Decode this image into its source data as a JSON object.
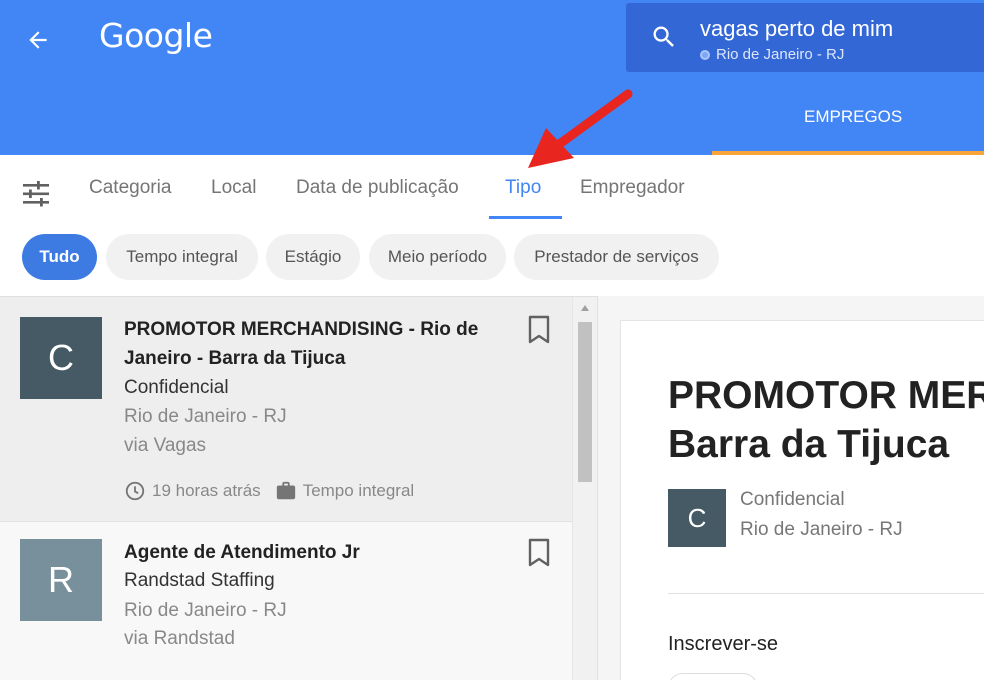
{
  "header": {
    "logo": "Google",
    "search_query": "vagas perto de mim",
    "search_location": "Rio de Janeiro - RJ",
    "tab_label": "EMPREGOS",
    "colors": {
      "bar": "#4285f4",
      "search": "#3367d6",
      "tab_underline": "#f9a53c"
    }
  },
  "filter_tabs": [
    {
      "label": "Categoria",
      "active": false
    },
    {
      "label": "Local",
      "active": false
    },
    {
      "label": "Data de publicação",
      "active": false
    },
    {
      "label": "Tipo",
      "active": true
    },
    {
      "label": "Empregador",
      "active": false
    }
  ],
  "chips": [
    {
      "label": "Tudo",
      "active": true
    },
    {
      "label": "Tempo integral",
      "active": false
    },
    {
      "label": "Estágio",
      "active": false
    },
    {
      "label": "Meio período",
      "active": false
    },
    {
      "label": "Prestador de serviços",
      "active": false
    }
  ],
  "jobs": [
    {
      "initial": "C",
      "avatar_color": "#455a64",
      "title": "PROMOTOR MERCHANDISING - Rio de Janeiro - Barra da Tijuca",
      "company": "Confidencial",
      "location": "Rio de Janeiro - RJ",
      "via": "via Vagas",
      "posted": "19 horas atrás",
      "type": "Tempo integral",
      "selected": true
    },
    {
      "initial": "R",
      "avatar_color": "#78909c",
      "title": "Agente de Atendimento Jr",
      "company": "Randstad Staffing",
      "location": "Rio de Janeiro - RJ",
      "via": "via Randstad",
      "selected": false
    }
  ],
  "detail": {
    "title_line1": "PROMOTOR MERCHANDISING - Rio de Janeiro -",
    "title_line2": "Barra da Tijuca",
    "initial": "C",
    "company": "Confidencial",
    "location": "Rio de Janeiro - RJ",
    "apply_label": "Inscrever-se"
  }
}
